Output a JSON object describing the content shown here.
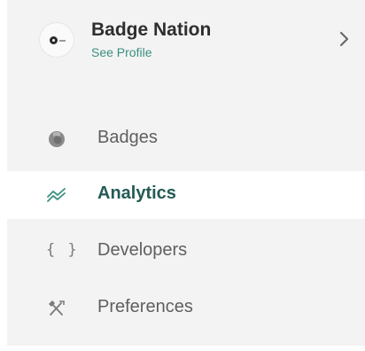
{
  "profile": {
    "name": "Badge Nation",
    "link_label": "See Profile",
    "avatar_icon": "badge-nation-logo",
    "chevron_icon": "chevron-right-icon"
  },
  "nav": {
    "items": [
      {
        "label": "Badges",
        "icon": "badge-icon",
        "active": false
      },
      {
        "label": "Analytics",
        "icon": "analytics-trend-icon",
        "active": true
      },
      {
        "label": "Developers",
        "icon": "code-braces-icon",
        "active": false
      },
      {
        "label": "Preferences",
        "icon": "tools-icon",
        "active": false
      }
    ],
    "braces_glyph": "{ }"
  },
  "colors": {
    "sidebar_bg": "#f3f3f3",
    "active_bg": "#ffffff",
    "accent_green": "#3b8f80",
    "active_text": "#255b55",
    "text_default": "#5f5f5f",
    "icon_gray": "#7a7a7a"
  }
}
